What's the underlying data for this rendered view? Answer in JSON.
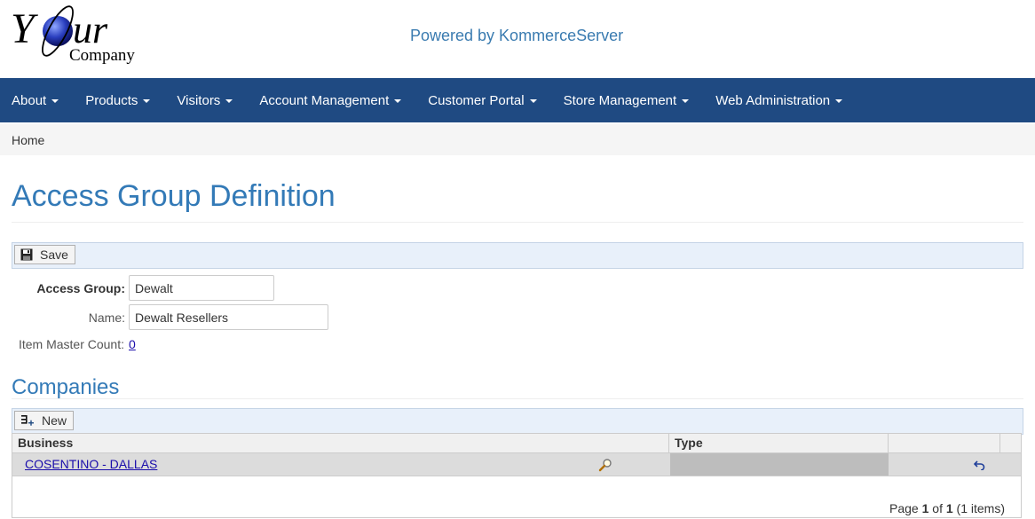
{
  "header": {
    "logo": {
      "word": "Your",
      "sub": "Company"
    },
    "powered_by": "Powered by KommerceServer"
  },
  "nav": {
    "items": [
      {
        "label": "About"
      },
      {
        "label": "Products"
      },
      {
        "label": "Visitors"
      },
      {
        "label": "Account Management"
      },
      {
        "label": "Customer Portal"
      },
      {
        "label": "Store Management"
      },
      {
        "label": "Web Administration"
      }
    ]
  },
  "breadcrumb": {
    "home": "Home"
  },
  "page": {
    "title": "Access Group Definition"
  },
  "toolbar": {
    "save_label": "Save"
  },
  "form": {
    "access_group_label": "Access Group:",
    "access_group_value": "Dewalt",
    "name_label": "Name:",
    "name_value": "Dewalt Resellers",
    "item_master_label": "Item Master Count:",
    "item_master_value": "0"
  },
  "companies": {
    "title": "Companies",
    "new_label": "New",
    "columns": {
      "business": "Business",
      "type": "Type"
    },
    "rows": [
      {
        "business": "COSENTINO - DALLAS",
        "type": ""
      }
    ],
    "pager": {
      "prefix": "Page",
      "page": "1",
      "of": "of",
      "total": "1",
      "items": "(1 items)"
    }
  },
  "colors": {
    "navbar": "#1f4a82",
    "title": "#337ab7",
    "link": "#1a0dab",
    "toolbar_bg": "#e8f0fa"
  },
  "icons": [
    "caret-down-icon",
    "floppy-disk-icon",
    "add-row-icon",
    "magnifier-icon",
    "undo-arrow-icon"
  ]
}
